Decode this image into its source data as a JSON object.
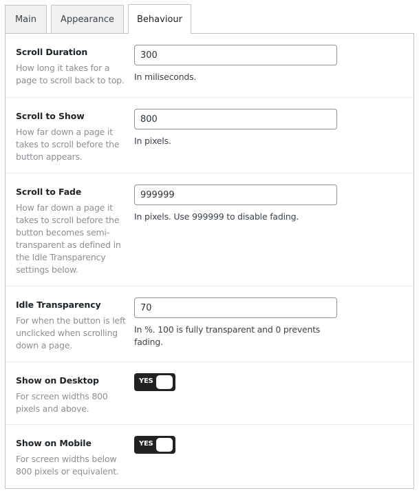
{
  "tabs": [
    {
      "label": "Main",
      "active": false
    },
    {
      "label": "Appearance",
      "active": false
    },
    {
      "label": "Behaviour",
      "active": true
    }
  ],
  "settings": {
    "scroll_duration": {
      "title": "Scroll Duration",
      "description": "How long it takes for a page to scroll back to top.",
      "value": "300",
      "hint": "In miliseconds."
    },
    "scroll_to_show": {
      "title": "Scroll to Show",
      "description": "How far down a page it takes to scroll before the button appears.",
      "value": "800",
      "hint": "In pixels."
    },
    "scroll_to_fade": {
      "title": "Scroll to Fade",
      "description": "How far down a page it takes to scroll before the button becomes semi-transparent as defined in the Idle Transparency settings below.",
      "value": "999999",
      "hint": "In pixels. Use 999999 to disable fading."
    },
    "idle_transparency": {
      "title": "Idle Transparency",
      "description": "For when the button is left unclicked when scrolling down a page.",
      "value": "70",
      "hint": "In %. 100 is fully transparent and 0 prevents fading."
    },
    "show_on_desktop": {
      "title": "Show on Desktop",
      "description": "For screen widths 800 pixels and above.",
      "toggle_label": "YES",
      "enabled": true
    },
    "show_on_mobile": {
      "title": "Show on Mobile",
      "description": "For screen widths below 800 pixels or equivalent.",
      "toggle_label": "YES",
      "enabled": true
    }
  },
  "colors": {
    "toggle_bg": "#222222",
    "description_text": "#8c8f94",
    "border": "#c3c4c7"
  }
}
